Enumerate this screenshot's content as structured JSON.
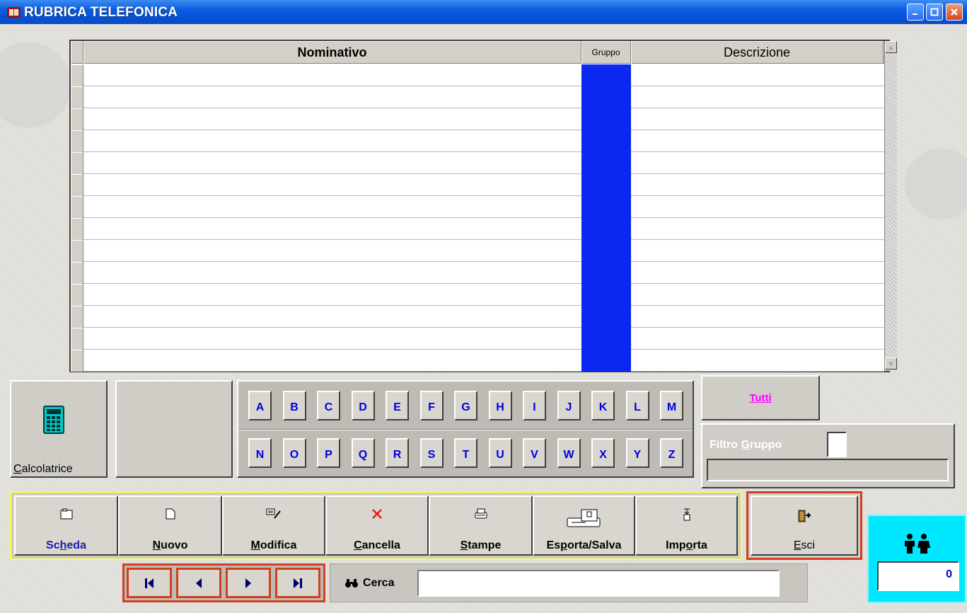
{
  "window": {
    "title": "RUBRICA TELEFONICA"
  },
  "grid": {
    "columns": [
      "Nominativo",
      "Gruppo",
      "Descrizione"
    ],
    "row_count": 14,
    "group_color": "#0a28f0"
  },
  "calc": {
    "label_pre": "",
    "label_acc": "C",
    "label_post": "alcolatrice"
  },
  "alphabet": {
    "row1": [
      "A",
      "B",
      "C",
      "D",
      "E",
      "F",
      "G",
      "H",
      "I",
      "J",
      "K",
      "L",
      "M"
    ],
    "row2": [
      "N",
      "O",
      "P",
      "Q",
      "R",
      "S",
      "T",
      "U",
      "V",
      "W",
      "X",
      "Y",
      "Z"
    ]
  },
  "filter": {
    "all_label": "Tutti",
    "group_label_pre": "Filtro ",
    "group_label_acc": "G",
    "group_label_post": "ruppo"
  },
  "toolbar": {
    "buttons": [
      {
        "pre": "Sc",
        "acc": "h",
        "post": "eda",
        "icon": "card-icon",
        "color": "#1a1ab0"
      },
      {
        "pre": "",
        "acc": "N",
        "post": "uovo",
        "icon": "new-document-icon",
        "color": "#000000"
      },
      {
        "pre": "",
        "acc": "M",
        "post": "odifica",
        "icon": "edit-icon",
        "color": "#000000"
      },
      {
        "pre": "",
        "acc": "C",
        "post": "ancella",
        "icon": "delete-x-icon",
        "color": "#000000"
      },
      {
        "pre": "",
        "acc": "S",
        "post": "tampe",
        "icon": "printer-icon",
        "color": "#000000"
      },
      {
        "pre": "Es",
        "acc": "p",
        "post": "orta/Salva",
        "icon": "export-save-icon",
        "color": "#000000"
      },
      {
        "pre": "Imp",
        "acc": "o",
        "post": "rta",
        "icon": "import-icon",
        "color": "#000000"
      }
    ],
    "exit": {
      "pre": "",
      "acc": "E",
      "post": "sci",
      "icon": "exit-door-icon"
    }
  },
  "counter": {
    "value": "0",
    "icon": "people-icon"
  },
  "navigation": {
    "buttons": [
      "first-record-icon",
      "previous-record-icon",
      "next-record-icon",
      "last-record-icon"
    ]
  },
  "search": {
    "label": "Cerca",
    "value": "",
    "icon": "binoculars-icon"
  }
}
